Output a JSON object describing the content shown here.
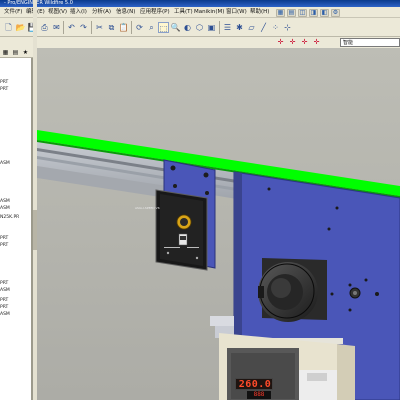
{
  "window": {
    "title": "- Pro/ENGINEER Wildfire 5.0"
  },
  "menu": {
    "items": [
      {
        "label": "文件(F)"
      },
      {
        "label": "编辑(E)"
      },
      {
        "label": "视图(V)"
      },
      {
        "label": "插入(I)"
      },
      {
        "label": "分析(A)"
      },
      {
        "label": "信息(N)"
      },
      {
        "label": "应用程序(P)"
      },
      {
        "label": "工具(T)"
      },
      {
        "label": "Manikin(M)"
      },
      {
        "label": "窗口(W)"
      },
      {
        "label": "帮助(H)"
      }
    ]
  },
  "filter": {
    "placeholder": "智能"
  },
  "model_tree": {
    "items": [
      {
        "label": "PRT"
      },
      {
        "label": "PRT"
      },
      {
        "label": "ASM"
      },
      {
        "label": "ASM"
      },
      {
        "label": "ASM"
      },
      {
        "label": "N25K.PR"
      },
      {
        "label": "PRT"
      },
      {
        "label": "PRT"
      },
      {
        "label": "PRT"
      },
      {
        "label": "ASM"
      },
      {
        "label": "PRT"
      },
      {
        "label": "PRT"
      },
      {
        "label": "ASM"
      }
    ]
  },
  "viewport": {
    "controller_text": "ASIA-I-SPEED V6",
    "display_value": "260.0",
    "display_value_2": "888"
  },
  "colors": {
    "rail_green": "#00ff00",
    "plate_blue": "#4a56b8",
    "accent": "#2d63c7"
  },
  "icons": {
    "toolbar": [
      "new-icon",
      "open-icon",
      "save-icon",
      "print-icon",
      "mail-icon",
      "undo-icon",
      "redo-icon",
      "cut-icon",
      "copy-icon",
      "paste-icon",
      "regen-icon",
      "find-icon",
      "select-icon",
      "zoom-icon",
      "repaint-icon",
      "orient-icon",
      "view-icon",
      "layer-icon",
      "spin-center-icon",
      "datum-plane-icon",
      "datum-axis-icon",
      "datum-point-icon",
      "csys-icon"
    ]
  }
}
